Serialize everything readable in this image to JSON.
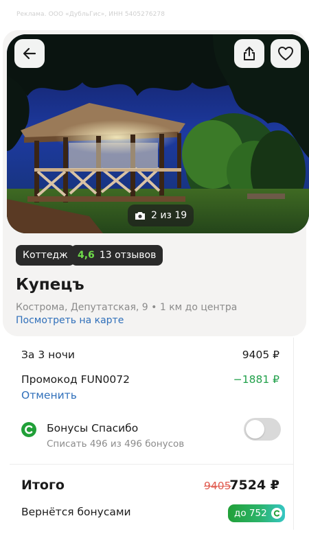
{
  "ad": {
    "text": "Реклама. ООО «ДубльГис», ИНН 5405276278"
  },
  "gallery": {
    "counter": "2 из 19"
  },
  "tags": {
    "type": "Коттедж",
    "rating": "4,6",
    "reviews": "13 отзывов"
  },
  "hotel": {
    "name": "Купецъ",
    "address": "Кострома, Депутатская, 9 • 1 км до центра",
    "map_link": "Посмотреть на карте"
  },
  "price": {
    "nights_label": "За 3 ночи",
    "nights_value": "9405 ₽",
    "promo_label": "Промокод FUN0072",
    "promo_value": "−1881 ₽",
    "cancel": "Отменить",
    "bonus_title": "Бонусы Спасибо",
    "bonus_sub": "Списать 496 из 496 бонусов",
    "bonus_toggle_on": false,
    "total_label": "Итого",
    "total_old": "9405",
    "total_new": "7524 ₽",
    "return_label": "Вернётся бонусами",
    "return_badge": "до 752"
  },
  "colors": {
    "accent_green": "#22a14b",
    "link_blue": "#2f6fba",
    "rating_green": "#6fdc4a",
    "old_price_red": "#e05b4f"
  },
  "icons": {
    "back": "arrow-left-icon",
    "share": "share-icon",
    "favorite": "heart-icon",
    "camera": "camera-icon",
    "sber": "sber-spasibo-icon"
  }
}
